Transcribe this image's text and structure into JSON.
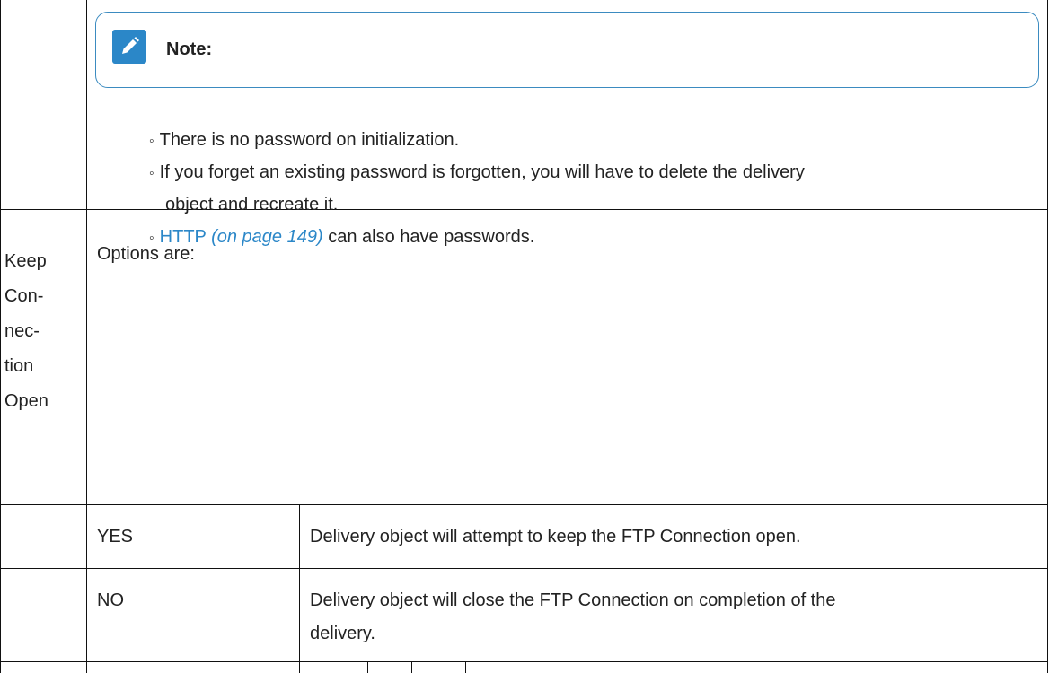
{
  "note": {
    "icon": "pencil-edit-icon",
    "title": "Note:",
    "border_color": "#3b8bc0",
    "icon_color": "#2b87c8"
  },
  "bullets": [
    {
      "marker": "◦",
      "text": "There is no password on initialization."
    },
    {
      "marker": "◦",
      "line1": "If you forget an existing password is forgotten, you will have to delete the delivery",
      "line2": "object and recreate it."
    },
    {
      "marker": "◦",
      "link_text": "HTTP",
      "link_ref": "(on page 149)",
      "rest": " can also have passwords."
    }
  ],
  "keep_connection": {
    "label_lines": [
      "Keep",
      "Con-",
      "nec-",
      "tion",
      "Open"
    ],
    "description": "Options are:"
  },
  "options": [
    {
      "value": "YES",
      "description": "Delivery object will attempt to keep the FTP Connection open."
    },
    {
      "value": "NO",
      "description_line1": "Delivery object will close the FTP Connection on completion of the",
      "description_line2": "delivery."
    }
  ],
  "link_color": "#2b87c8"
}
